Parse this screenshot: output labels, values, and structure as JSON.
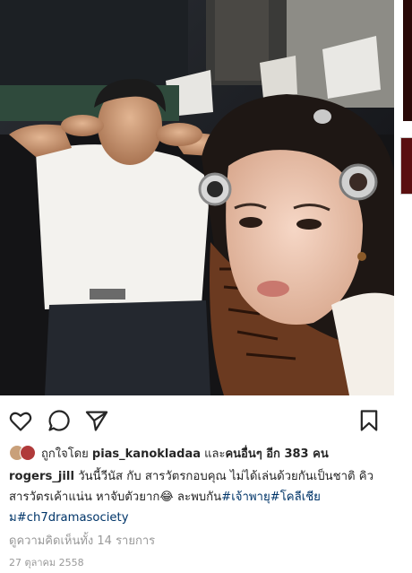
{
  "post": {
    "photo_alt": "selfie photo",
    "likes": {
      "prefix": "ถูกใจโดย",
      "user": "pias_kanokladaa",
      "connector": "และ",
      "others_label": "คนอื่นๆ อีก 383 คน"
    },
    "caption": {
      "username": "rogers_jill",
      "text": "วันนี้วีนัส กับ สารวัตรกอบคุณ ไม่ได้เล่นด้วยกันเป็นชาติ คิวสารวัตรเค้าแน่น หาจับตัวยาก😂 ละพบกัน",
      "tag1": "#เจ้าพายุ",
      "tag2": "#โคลีเชียม",
      "tag3": "#ch7dramasociety"
    },
    "comments_link": "ดูความคิดเห็นทั้ง 14 รายการ",
    "date": "27 ตุลาคม 2558"
  },
  "icons": {
    "like": "heart-icon",
    "comment": "comment-bubble-icon",
    "share": "paper-plane-icon",
    "save": "bookmark-icon"
  },
  "colors": {
    "text": "#262626",
    "hashtag": "#003569",
    "muted": "#999999"
  }
}
